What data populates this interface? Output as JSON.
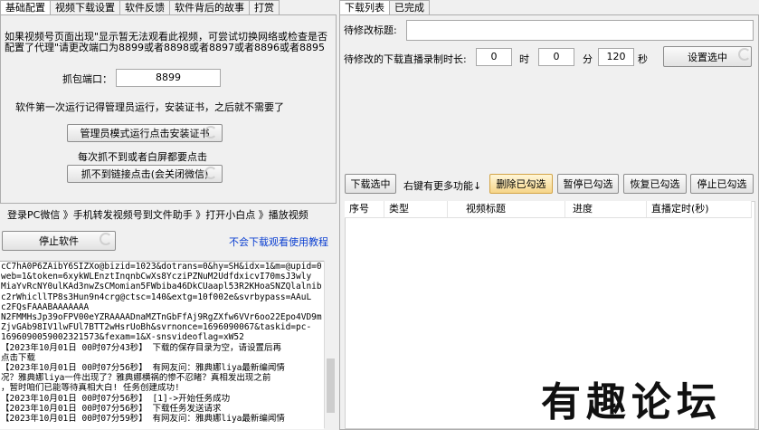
{
  "left_tabs": [
    "基础配置",
    "视频下载设置",
    "软件反馈",
    "软件背后的故事",
    "打赏"
  ],
  "right_tabs": [
    "下载列表",
    "已完成"
  ],
  "config": {
    "notice": "如果视频号页面出现\"显示暂无法观看此视频，可尝试切换网络或检查是否配置了代理\"请更改端口为8899或者8898或者8897或者8896或者8895",
    "port_label": "抓包端口：",
    "port_value": "8899",
    "cert_hint": "软件第一次运行记得管理员运行，安装证书，之后就不需要了",
    "admin_button": "管理员模式运行点击安装证书",
    "retry_hint": "每次抓不到或者白屏都要点击",
    "close_wechat_button": "抓不到链接点击(会关闭微信)"
  },
  "steps_text": "登录PC微信 》手机转发视频号到文件助手 》打开小白点 》播放视频",
  "stop_button": "停止软件",
  "tutorial_link": "不会下载观看使用教程",
  "log_lines": [
    "cC7hA0P6ZAibY6SIZXo@bizid=1023&dotrans=0&hy=SH&idx=1&m=@upid=0",
    "web=1&token=6xykWLEnztInqnbCwXs8YcziPZNuM2UdfdxicvI70msJ3wly",
    "MiaYvRcNY0ulKAd3nwZsCMomian5FWbiba46DkCUaapl53R2KHoaSNZQlalnib",
    "c2rWhicllTP8s3Hun9n4crg@ctsc=140&extg=10f002e&svrbypass=AAuL",
    "c2FQsFAAABAAAAAAA",
    "N2FMMHsJp39oFPV00eYZRAAAADnaMZTnGbFfAj9RgZXfw6VVr6oo22Epo4VD9m",
    "ZjvGAb98IV1lwFUl7BTT2wHsrUoBh&svrnonce=1696090067&taskid=pc-",
    "1696090059002321573&fexam=1&X-snsvideoflag=xW52",
    "【2023年10月01日 00时07分43秒】 下载的保存目录为空，请设置后再",
    "点击下载",
    "【2023年10月01日 00时07分56秒】 有网友问：雅典娜liya最新编闻情",
    "况？雅典娜liya一件出现了？雅典娜横祸的惨不忍睹？真相发出现之前",
    "，暂时咱们已能等待真相大白! 任务创建成功!",
    "【2023年10月01日 00时07分56秒】 [1]->开始任务成功",
    "【2023年10月01日 00时07分56秒】 下载任务发送请求",
    "【2023年10月01日 00时07分59秒】 有网友问：雅典娜liya最新编闻情"
  ],
  "right": {
    "title_label": "待修改标题:",
    "title_value": "",
    "duration_label": "待修改的下载直播录制时长:",
    "hours": "0",
    "hours_unit": "时",
    "minutes": "0",
    "minutes_unit": "分",
    "seconds": "120",
    "seconds_unit": "秒",
    "set_selected_button": "设置选中",
    "download_selected": "下载选中",
    "more_hint": "右键有更多功能↓",
    "delete_checked": "删除已勾选",
    "pause_checked": "暂停已勾选",
    "resume_checked": "恢复已勾选",
    "stop_checked": "停止已勾选",
    "columns": [
      "序号",
      "类型",
      "视频标题",
      "进度",
      "直播定时(秒)"
    ]
  },
  "watermark": "有趣论坛"
}
